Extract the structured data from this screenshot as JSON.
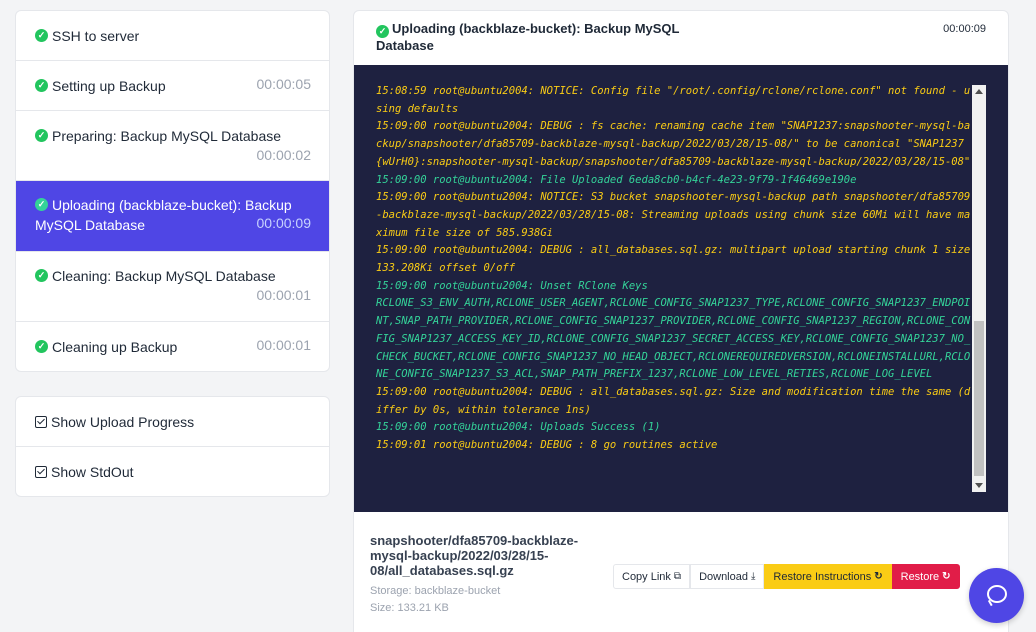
{
  "steps": [
    {
      "label": "SSH to server",
      "time": ""
    },
    {
      "label": "Setting up Backup",
      "time": "00:00:05"
    },
    {
      "label": "Preparing: Backup MySQL Database",
      "time": "00:00:02"
    },
    {
      "label": "Uploading (backblaze-bucket): Backup MySQL Database",
      "time": "00:00:09"
    },
    {
      "label": "Cleaning: Backup MySQL Database",
      "time": "00:00:01"
    },
    {
      "label": "Cleaning up Backup",
      "time": "00:00:01"
    }
  ],
  "options": [
    {
      "label": "Show Upload Progress",
      "checked": true
    },
    {
      "label": "Show StdOut",
      "checked": true
    }
  ],
  "main": {
    "title": "Uploading (backblaze-bucket): Backup MySQL Database",
    "time": "00:00:09"
  },
  "console": {
    "lines": [
      {
        "level": "notice",
        "text": "15:08:59 root@ubuntu2004: NOTICE: Config file \"/root/.config/rclone/rclone.conf\" not found - using defaults"
      },
      {
        "level": "debug",
        "text": "15:09:00 root@ubuntu2004: DEBUG : fs cache: renaming cache item \"SNAP1237:snapshooter-mysql-backup/snapshooter/dfa85709-backblaze-mysql-backup/2022/03/28/15-08/\" to be canonical \"SNAP1237{wUrH0}:snapshooter-mysql-backup/snapshooter/dfa85709-backblaze-mysql-backup/2022/03/28/15-08\""
      },
      {
        "level": "info",
        "text": "15:09:00 root@ubuntu2004: File Uploaded 6eda8cb0-b4cf-4e23-9f79-1f46469e190e"
      },
      {
        "level": "notice",
        "text": "15:09:00 root@ubuntu2004: NOTICE: S3 bucket snapshooter-mysql-backup path snapshooter/dfa85709-backblaze-mysql-backup/2022/03/28/15-08: Streaming uploads using chunk size 60Mi will have maximum file size of 585.938Gi"
      },
      {
        "level": "debug",
        "text": "15:09:00 root@ubuntu2004: DEBUG : all_databases.sql.gz: multipart upload starting chunk 1 size 133.208Ki offset 0/off"
      },
      {
        "level": "info",
        "text": "15:09:00 root@ubuntu2004: Unset RClone Keys"
      },
      {
        "level": "info",
        "text": "RCLONE_S3_ENV_AUTH,RCLONE_USER_AGENT,RCLONE_CONFIG_SNAP1237_TYPE,RCLONE_CONFIG_SNAP1237_ENDPOINT,SNAP_PATH_PROVIDER,RCLONE_CONFIG_SNAP1237_PROVIDER,RCLONE_CONFIG_SNAP1237_REGION,RCLONE_CONFIG_SNAP1237_ACCESS_KEY_ID,RCLONE_CONFIG_SNAP1237_SECRET_ACCESS_KEY,RCLONE_CONFIG_SNAP1237_NO_CHECK_BUCKET,RCLONE_CONFIG_SNAP1237_NO_HEAD_OBJECT,RCLONEREQUIREDVERSION,RCLONEINSTALLURL,RCLONE_CONFIG_SNAP1237_S3_ACL,SNAP_PATH_PREFIX_1237,RCLONE_LOW_LEVEL_RETIES,RCLONE_LOG_LEVEL"
      },
      {
        "level": "debug",
        "text": "15:09:00 root@ubuntu2004: DEBUG : all_databases.sql.gz: Size and modification time the same (differ by 0s, within tolerance 1ns)"
      },
      {
        "level": "info",
        "text": "15:09:00 root@ubuntu2004: Uploads Success (1)"
      },
      {
        "level": "debug",
        "text": "15:09:01 root@ubuntu2004: DEBUG : 8 go routines active"
      }
    ]
  },
  "file": {
    "name": "snapshooter/dfa85709-backblaze-mysql-backup/2022/03/28/15-08/all_databases.sql.gz",
    "storage": "Storage: backblaze-bucket",
    "size": "Size: 133.21 KB"
  },
  "actions": {
    "copy_link": "Copy Link",
    "download": "Download",
    "restore_instructions": "Restore Instructions",
    "restore": "Restore"
  },
  "colors": {
    "accent": "#4f46e5",
    "success": "#22c55e",
    "console_bg": "#1e2140",
    "console_yellow": "#facc15",
    "console_green": "#34d399",
    "restore_red": "#e11d48"
  }
}
